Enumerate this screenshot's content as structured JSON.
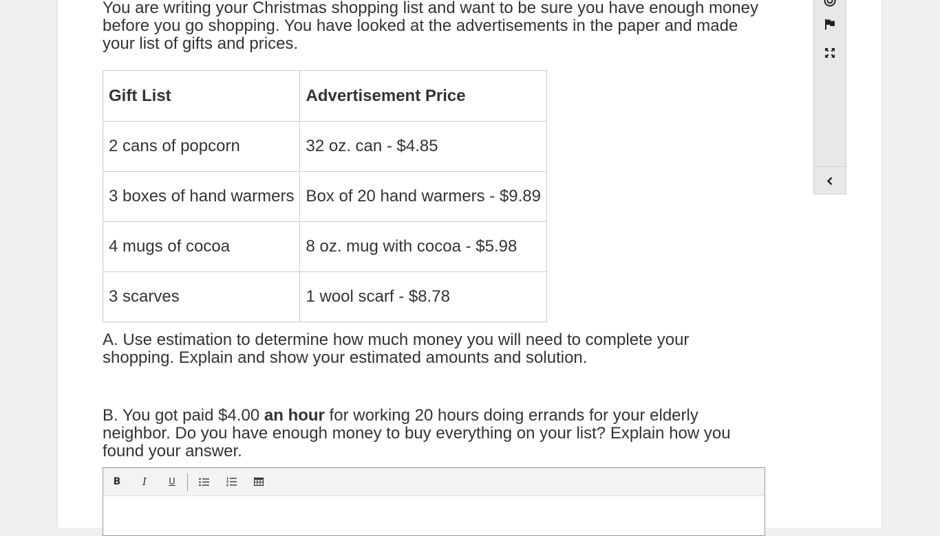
{
  "question": {
    "intro": "You are writing your Christmas shopping list and want to be sure you have enough money before you go shopping. You have looked at the advertisements in the paper and made your list of gifts and prices.",
    "table": {
      "headers": [
        "Gift List",
        "Advertisement Price"
      ],
      "rows": [
        [
          "2 cans of popcorn",
          "32 oz. can - $4.85"
        ],
        [
          "3 boxes of hand warmers",
          "Box of 20 hand warmers - $9.89"
        ],
        [
          "4 mugs of cocoa",
          "8 oz. mug with cocoa - $5.98"
        ],
        [
          "3 scarves",
          "1 wool scarf - $8.78"
        ]
      ]
    },
    "part_a": "A. Use estimation to determine how much money you will need to complete your shopping. Explain and show your estimated amounts and solution.",
    "part_b": {
      "before": "B. You got paid $4.00 ",
      "bold": "an hour",
      "after": " for working 20 hours doing errands for your elderly neighbor. Do you have enough money to buy everything on your list? Explain how you found your answer."
    }
  },
  "editor": {
    "toolbar": {
      "bold": "B",
      "italic": "I",
      "underline": "U"
    },
    "icons": [
      "bold-icon",
      "italic-icon",
      "underline-icon",
      "bullet-list-icon",
      "numbered-list-icon",
      "table-icon"
    ],
    "value": ""
  },
  "sidebar": {
    "icons": [
      "target-icon",
      "flag-icon",
      "expand-icon",
      "chevron-left-icon"
    ]
  }
}
